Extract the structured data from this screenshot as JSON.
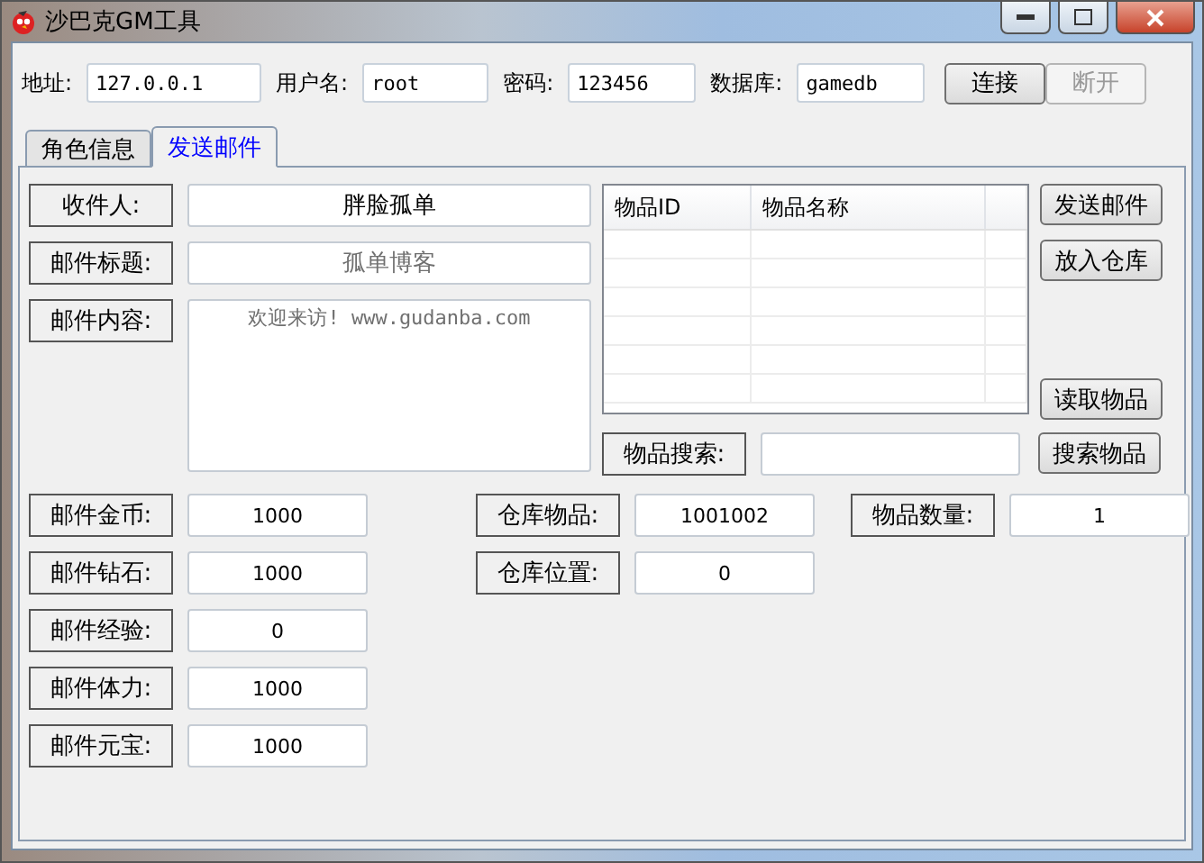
{
  "window": {
    "title": "沙巴克GM工具"
  },
  "connection": {
    "fields": [
      {
        "label": "地址:",
        "value": "127.0.0.1"
      },
      {
        "label": "用户名:",
        "value": "root"
      },
      {
        "label": "密码:",
        "value": "123456"
      },
      {
        "label": "数据库:",
        "value": "gamedb"
      }
    ],
    "buttons": [
      {
        "label": "连接",
        "disabled": false
      },
      {
        "label": "断开",
        "disabled": true
      }
    ]
  },
  "tabs": [
    {
      "label": "角色信息",
      "selected": false
    },
    {
      "label": "发送邮件",
      "selected": true
    }
  ],
  "mail": {
    "recipient": {
      "label": "收件人:",
      "value": "胖脸孤单"
    },
    "subject": {
      "label": "邮件标题:",
      "placeholder": "孤单博客"
    },
    "content": {
      "label": "邮件内容:",
      "placeholder": "欢迎来访! www.gudanba.com"
    }
  },
  "table": {
    "columns": [
      "物品ID",
      "物品名称"
    ]
  },
  "side_buttons": [
    "发送邮件",
    "放入仓库",
    "读取物品"
  ],
  "search": {
    "label": "物品搜索:",
    "button": "搜索物品"
  },
  "rows": [
    [
      {
        "label": "邮件金币:",
        "value": "1000"
      },
      {
        "label": "仓库物品:",
        "value": "1001002"
      },
      {
        "label": "物品数量:",
        "value": "1"
      }
    ],
    [
      {
        "label": "邮件钻石:",
        "value": "1000"
      },
      {
        "label": "仓库位置:",
        "value": "0"
      }
    ],
    [
      {
        "label": "邮件经验:",
        "value": "0"
      }
    ],
    [
      {
        "label": "邮件体力:",
        "value": "1000"
      }
    ],
    [
      {
        "label": "邮件元宝:",
        "value": "1000"
      }
    ]
  ]
}
